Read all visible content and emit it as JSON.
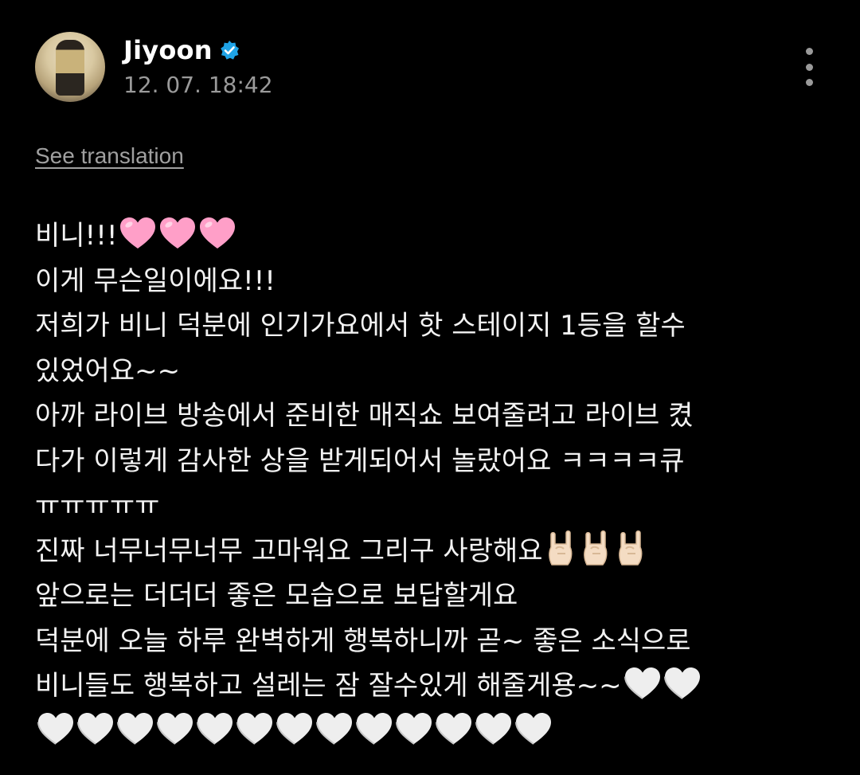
{
  "post": {
    "author": "Jiyoon",
    "timestamp": "12. 07. 18:42",
    "see_translation": "See translation",
    "lines": [
      "비니!!!",
      "이게 무슨일이에요!!!",
      "저희가 비니 덕분에 인기가요에서 핫 스테이지 1등을 할수",
      "있었어요~~",
      "아까 라이브 방송에서 준비한 매직쇼 보여줄려고 라이브 켰",
      "다가 이렇게 감사한 상을 받게되어서 놀랐어요 ㅋㅋㅋㅋ큐",
      "ㅠㅠㅠㅠㅠ",
      "진짜 너무너무너무 고마워요 그리구 사랑해요",
      "앞으로는 더더더 좋은 모습으로 보답할게요",
      "덕분에 오늘 하루 완벽하게 행복하니까 곧~ 좋은 소식으로",
      "비니들도 행복하고 설레는 잠 잘수있게 해줄게용~~",
      ""
    ],
    "emojis": {
      "line1": [
        "pink-heart-icon",
        "pink-heart-icon",
        "pink-heart-icon"
      ],
      "line8": [
        "sign-of-horns-icon",
        "sign-of-horns-icon",
        "sign-of-horns-icon"
      ],
      "line11": [
        "white-heart-icon",
        "white-heart-icon"
      ],
      "line12": [
        "white-heart-icon",
        "white-heart-icon",
        "white-heart-icon",
        "white-heart-icon",
        "white-heart-icon",
        "white-heart-icon",
        "white-heart-icon",
        "white-heart-icon",
        "white-heart-icon",
        "white-heart-icon",
        "white-heart-icon",
        "white-heart-icon",
        "white-heart-icon"
      ]
    }
  },
  "colors": {
    "background": "#000000",
    "text": "#f2f2f2",
    "muted": "#9a9a9a",
    "verified": "#1fa3e6",
    "pink_heart": "#ff9fc8"
  }
}
